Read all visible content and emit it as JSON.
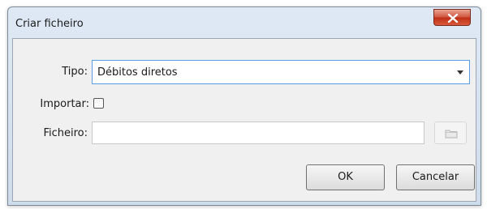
{
  "dialog": {
    "title": "Criar ficheiro"
  },
  "form": {
    "tipo_label": "Tipo:",
    "tipo_value": "Débitos diretos",
    "importar_label": "Importar:",
    "importar_checked": false,
    "ficheiro_label": "Ficheiro:",
    "ficheiro_value": ""
  },
  "buttons": {
    "ok": "OK",
    "cancel": "Cancelar"
  },
  "icons": {
    "close": "close-icon",
    "browse": "folder-icon",
    "dropdown": "chevron-down-icon"
  }
}
